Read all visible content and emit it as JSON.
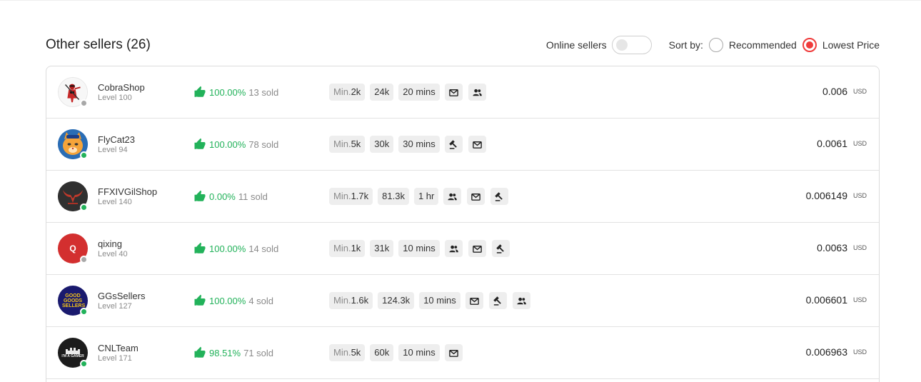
{
  "header": {
    "title": "Other sellers (26)",
    "online_label": "Online sellers",
    "sort_label": "Sort by:",
    "sort_options": [
      "Recommended",
      "Lowest Price"
    ],
    "sort_selected": "Lowest Price"
  },
  "sellers": [
    {
      "name": "CobraShop",
      "level": "Level 100",
      "online": false,
      "rating": "100.00%",
      "sold": "13 sold",
      "min_prefix": "Min.",
      "min": "2k",
      "stock": "24k",
      "delivery": "20 mins",
      "features": [
        "mail-icon",
        "group-icon"
      ],
      "price": "0.006",
      "currency": "USD"
    },
    {
      "name": "FlyCat23",
      "level": "Level 94",
      "online": true,
      "rating": "100.00%",
      "sold": "78 sold",
      "min_prefix": "Min.",
      "min": "5k",
      "stock": "30k",
      "delivery": "30 mins",
      "features": [
        "auction-icon",
        "mail-icon"
      ],
      "price": "0.0061",
      "currency": "USD"
    },
    {
      "name": "FFXIVGilShop",
      "level": "Level 140",
      "online": true,
      "rating": "0.00%",
      "sold": "11 sold",
      "min_prefix": "Min.",
      "min": "1.7k",
      "stock": "81.3k",
      "delivery": "1 hr",
      "features": [
        "group-icon",
        "mail-icon",
        "auction-icon"
      ],
      "price": "0.006149",
      "currency": "USD"
    },
    {
      "name": "qixing",
      "level": "Level 40",
      "online": false,
      "avatar_letter": "Q",
      "rating": "100.00%",
      "sold": "14 sold",
      "min_prefix": "Min.",
      "min": "1k",
      "stock": "31k",
      "delivery": "10 mins",
      "features": [
        "group-icon",
        "mail-icon",
        "auction-icon"
      ],
      "price": "0.0063",
      "currency": "USD"
    },
    {
      "name": "GGsSellers",
      "level": "Level 127",
      "online": true,
      "avatar_text": "GOOD GOODS SELLERS",
      "rating": "100.00%",
      "sold": "4 sold",
      "min_prefix": "Min.",
      "min": "1.6k",
      "stock": "124.3k",
      "delivery": "10 mins",
      "features": [
        "mail-icon",
        "auction-icon",
        "group-icon"
      ],
      "price": "0.006601",
      "currency": "USD"
    },
    {
      "name": "CNLTeam",
      "level": "Level 171",
      "online": true,
      "avatar_text": "I'M A GAMER",
      "rating": "98.51%",
      "sold": "71 sold",
      "min_prefix": "Min.",
      "min": "5k",
      "stock": "60k",
      "delivery": "10 mins",
      "features": [
        "mail-icon"
      ],
      "price": "0.006963",
      "currency": "USD"
    }
  ],
  "colors": {
    "accent_red": "#ef3b3b",
    "positive_green": "#22b25a",
    "tag_bg": "#eeeeee"
  }
}
